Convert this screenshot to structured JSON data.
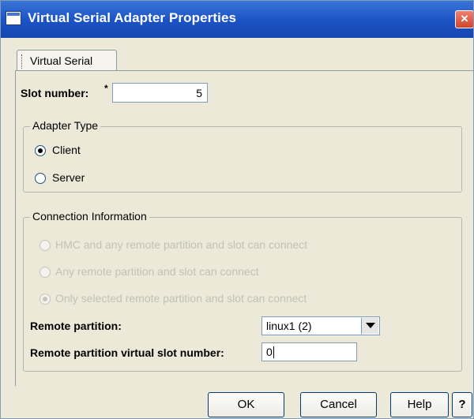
{
  "window": {
    "title": "Virtual Serial Adapter Properties",
    "close_glyph": "×"
  },
  "tabs": [
    {
      "label": "Virtual Serial"
    }
  ],
  "slot": {
    "label": "Slot number:",
    "required_mark": "*",
    "value": "5"
  },
  "adapter_type": {
    "legend": "Adapter Type",
    "options": [
      {
        "label": "Client",
        "selected": true
      },
      {
        "label": "Server",
        "selected": false
      }
    ]
  },
  "connection": {
    "legend": "Connection Information",
    "options": [
      {
        "label": "HMC and any remote partition and slot can connect",
        "selected": false,
        "enabled": false
      },
      {
        "label": "Any remote partition and slot can connect",
        "selected": false,
        "enabled": false
      },
      {
        "label": "Only selected remote partition and slot can connect",
        "selected": true,
        "enabled": false
      }
    ],
    "remote_partition_label": "Remote partition:",
    "remote_partition_value": "linux1 (2)",
    "remote_slot_label": "Remote partition virtual slot number:",
    "remote_slot_value": "0"
  },
  "buttons": {
    "ok": "OK",
    "cancel": "Cancel",
    "help": "Help",
    "help_question": "?"
  },
  "icons": {
    "app": "window-app-icon",
    "close": "close-icon",
    "dropdown": "chevron-down-icon"
  }
}
